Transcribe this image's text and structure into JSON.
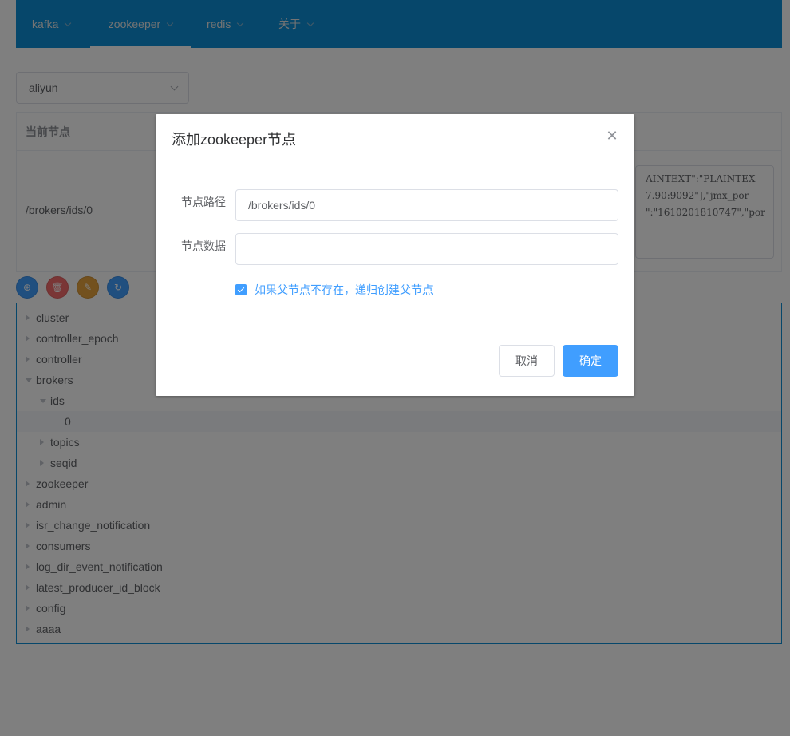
{
  "colors": {
    "navbar": "#0c8fd6",
    "primary": "#409eff",
    "danger": "#f56c6c",
    "warning": "#e6a23c"
  },
  "nav": {
    "items": [
      {
        "label": "kafka"
      },
      {
        "label": "zookeeper"
      },
      {
        "label": "redis"
      },
      {
        "label": "关于"
      }
    ],
    "active": "zookeeper"
  },
  "cluster_select": {
    "value": "aliyun"
  },
  "node_table": {
    "header": "当前节点",
    "path": "/brokers/ids/0",
    "data_lines": [
      "AINTEXT\":\"PLAINTEX",
      "7.90:9092\"],\"jmx_por",
      "\":\"1610201810747\",\"por"
    ]
  },
  "toolbar": {
    "add_icon": "plus-circle-icon",
    "delete_icon": "trash-icon",
    "edit_icon": "edit-icon",
    "refresh_icon": "refresh-icon"
  },
  "tree": {
    "nodes": [
      {
        "label": "cluster",
        "level": 0,
        "expanded": false
      },
      {
        "label": "controller_epoch",
        "level": 0,
        "expanded": false
      },
      {
        "label": "controller",
        "level": 0,
        "expanded": false
      },
      {
        "label": "brokers",
        "level": 0,
        "expanded": true
      },
      {
        "label": "ids",
        "level": 1,
        "expanded": true
      },
      {
        "label": "0",
        "level": 2,
        "leaf": true,
        "current": true
      },
      {
        "label": "topics",
        "level": 1,
        "expanded": false
      },
      {
        "label": "seqid",
        "level": 1,
        "expanded": false
      },
      {
        "label": "zookeeper",
        "level": 0,
        "expanded": false
      },
      {
        "label": "admin",
        "level": 0,
        "expanded": false
      },
      {
        "label": "isr_change_notification",
        "level": 0,
        "expanded": false
      },
      {
        "label": "consumers",
        "level": 0,
        "expanded": false
      },
      {
        "label": "log_dir_event_notification",
        "level": 0,
        "expanded": false
      },
      {
        "label": "latest_producer_id_block",
        "level": 0,
        "expanded": false
      },
      {
        "label": "config",
        "level": 0,
        "expanded": false
      },
      {
        "label": "aaaa",
        "level": 0,
        "expanded": false
      }
    ]
  },
  "dialog": {
    "title": "添加zookeeper节点",
    "path_label": "节点路径",
    "path_value": "/brokers/ids/0",
    "data_label": "节点数据",
    "data_value": "",
    "checkbox_label": "如果父节点不存在，递归创建父节点",
    "checkbox_checked": true,
    "cancel_label": "取消",
    "confirm_label": "确定"
  }
}
